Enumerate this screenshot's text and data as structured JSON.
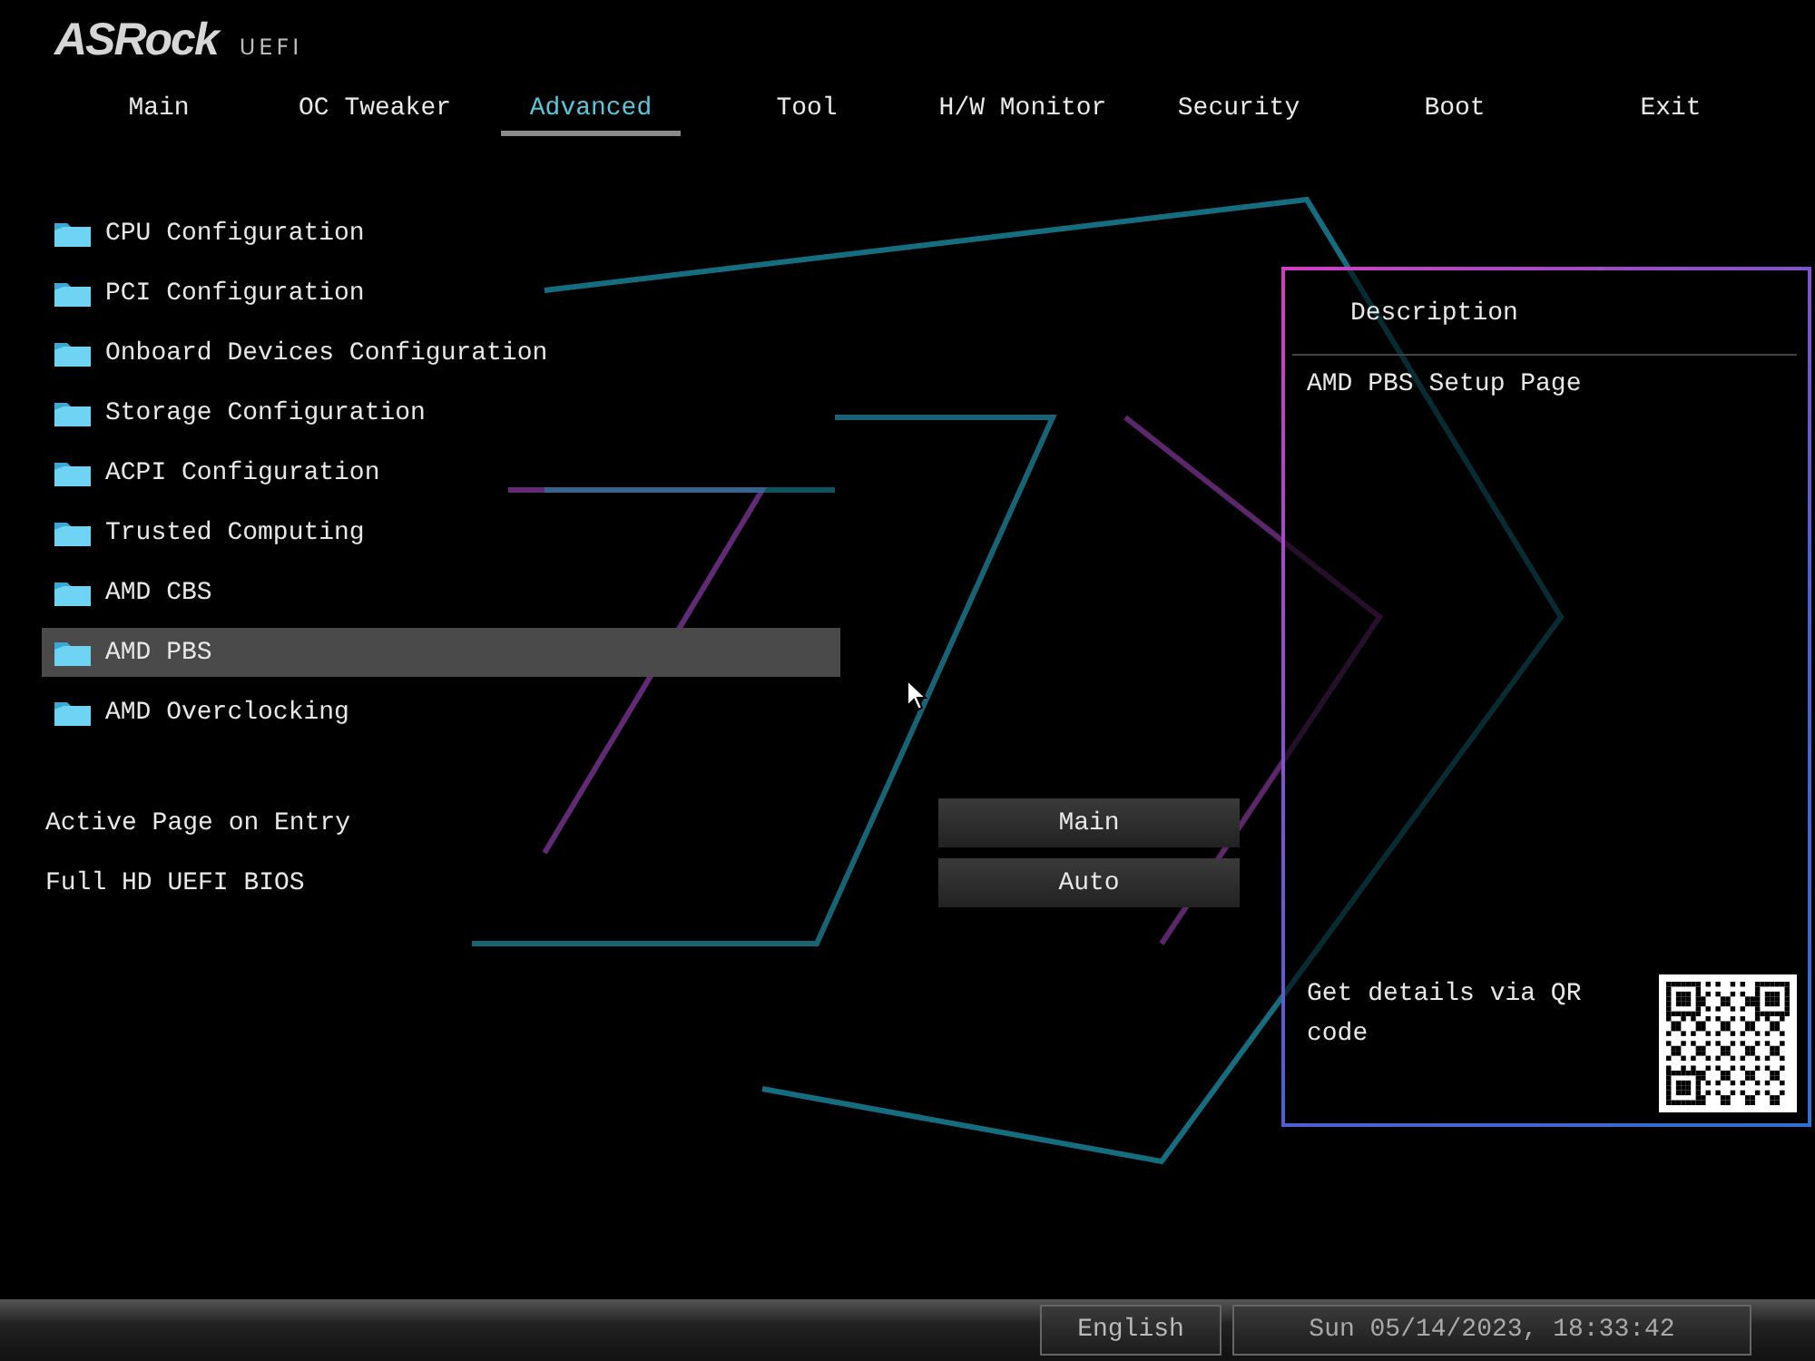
{
  "logo": {
    "brand": "ASRock",
    "product": "UEFI"
  },
  "tabs": [
    {
      "label": "Main",
      "selected": false
    },
    {
      "label": "OC Tweaker",
      "selected": false
    },
    {
      "label": "Advanced",
      "selected": true
    },
    {
      "label": "Tool",
      "selected": false
    },
    {
      "label": "H/W Monitor",
      "selected": false
    },
    {
      "label": "Security",
      "selected": false
    },
    {
      "label": "Boot",
      "selected": false
    },
    {
      "label": "Exit",
      "selected": false
    }
  ],
  "menu_items": [
    {
      "label": "CPU Configuration",
      "selected": false
    },
    {
      "label": "PCI Configuration",
      "selected": false
    },
    {
      "label": "Onboard Devices Configuration",
      "selected": false
    },
    {
      "label": "Storage Configuration",
      "selected": false
    },
    {
      "label": "ACPI Configuration",
      "selected": false
    },
    {
      "label": "Trusted Computing",
      "selected": false
    },
    {
      "label": "AMD CBS",
      "selected": false
    },
    {
      "label": "AMD PBS",
      "selected": true
    },
    {
      "label": "AMD Overclocking",
      "selected": false
    }
  ],
  "settings": [
    {
      "label": "Active Page on Entry",
      "value": "Main"
    },
    {
      "label": "Full HD UEFI BIOS",
      "value": "Auto"
    }
  ],
  "description": {
    "title": "Description",
    "text": "AMD PBS Setup Page",
    "qr_hint": "Get details via QR code"
  },
  "status_bar": {
    "language": "English",
    "datetime": "Sun 05/14/2023, 18:33:42"
  }
}
